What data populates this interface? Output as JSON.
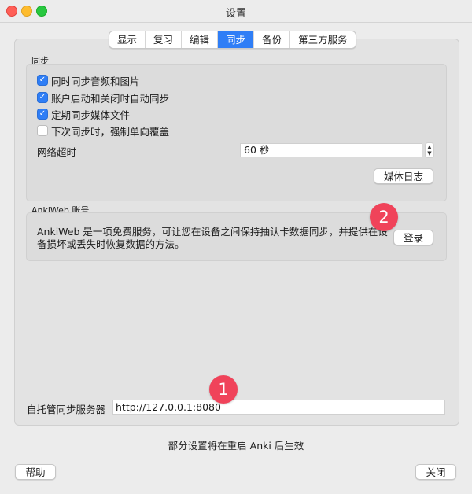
{
  "window": {
    "title": "设置"
  },
  "tabs": [
    {
      "label": "显示",
      "active": false
    },
    {
      "label": "复习",
      "active": false
    },
    {
      "label": "编辑",
      "active": false
    },
    {
      "label": "同步",
      "active": true
    },
    {
      "label": "备份",
      "active": false
    },
    {
      "label": "第三方服务",
      "active": false
    }
  ],
  "sync": {
    "section_label": "同步",
    "options": [
      {
        "label": "同时同步音频和图片",
        "checked": true
      },
      {
        "label": "账户启动和关闭时自动同步",
        "checked": true
      },
      {
        "label": "定期同步媒体文件",
        "checked": true
      },
      {
        "label": "下次同步时，强制单向覆盖",
        "checked": false
      }
    ],
    "timeout_label": "网络超时",
    "timeout_value": "60 秒",
    "media_log_button": "媒体日志"
  },
  "ankiweb": {
    "section_label": "AnkiWeb 账号",
    "description": "AnkiWeb 是一项免费服务，可让您在设备之间保持抽认卡数据同步，并提供在设备损坏或丢失时恢复数据的方法。",
    "login_button": "登录"
  },
  "self_hosted": {
    "label": "自托管同步服务器",
    "url_value": "http://127.0.0.1:8080"
  },
  "annotations": {
    "badge_1": "1",
    "badge_2": "2"
  },
  "footer": {
    "notice": "部分设置将在重启 Anki 后生效",
    "help_button": "帮助",
    "close_button": "关闭"
  },
  "colors": {
    "accent": "#2f7ef6",
    "badge": "#f0435a"
  }
}
